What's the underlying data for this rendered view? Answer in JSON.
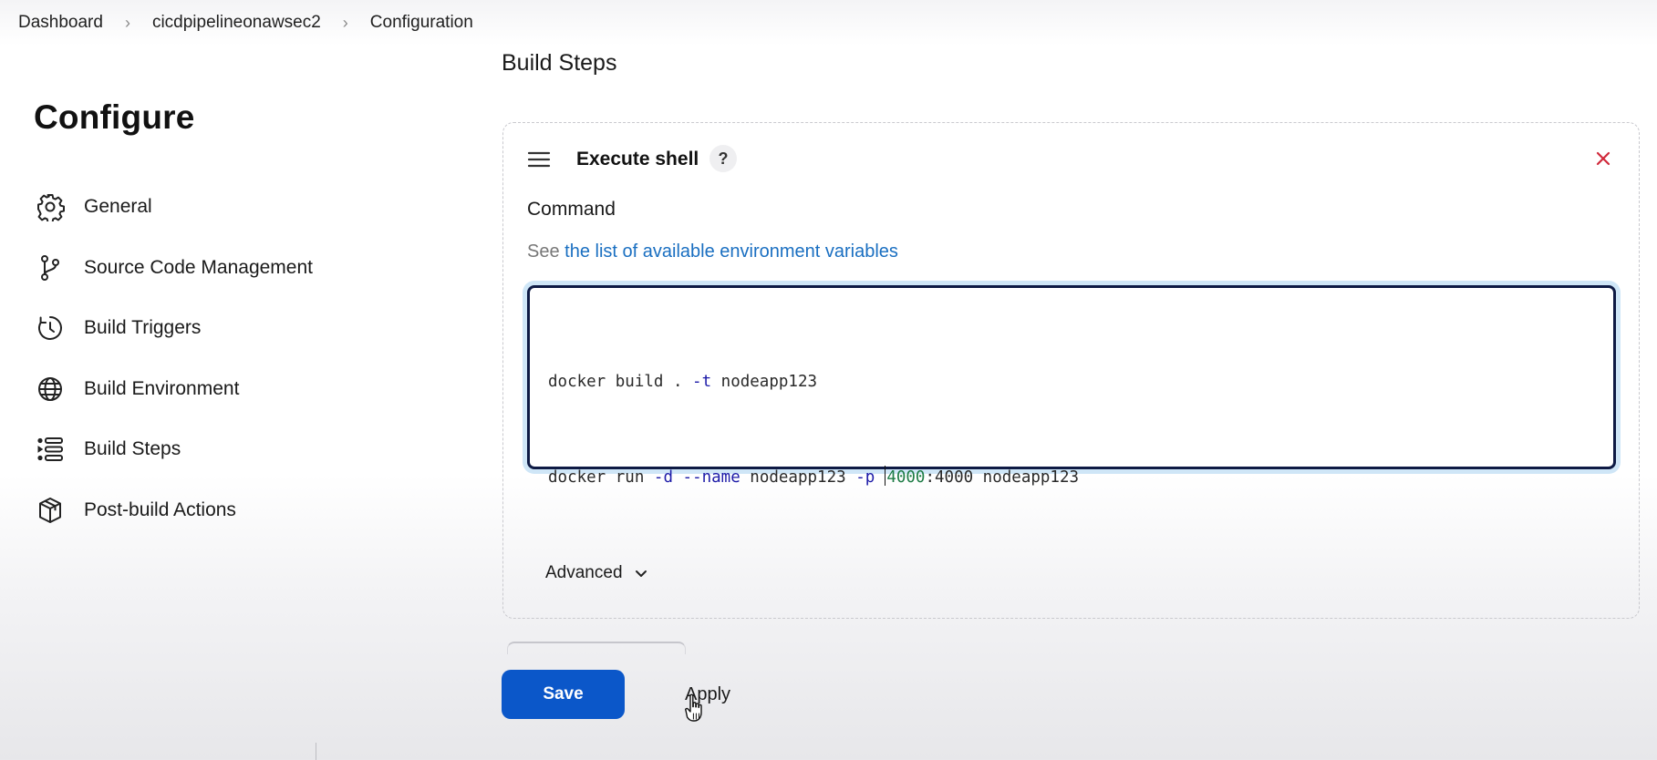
{
  "breadcrumb": {
    "items": [
      "Dashboard",
      "cicdpipelineonawsec2",
      "Configuration"
    ]
  },
  "sidebar": {
    "title": "Configure",
    "items": [
      {
        "label": "General",
        "icon": "gear-icon"
      },
      {
        "label": "Source Code Management",
        "icon": "git-branch-icon"
      },
      {
        "label": "Build Triggers",
        "icon": "clock-icon"
      },
      {
        "label": "Build Environment",
        "icon": "globe-icon"
      },
      {
        "label": "Build Steps",
        "icon": "list-icon"
      },
      {
        "label": "Post-build Actions",
        "icon": "package-icon"
      }
    ]
  },
  "main": {
    "section_title": "Build Steps",
    "step": {
      "title": "Execute shell",
      "help": "?",
      "command_label": "Command",
      "hint_prefix": "See",
      "hint_link": "the list of available environment variables",
      "command_lines": [
        "docker build . -t nodeapp123",
        "docker run -d --name nodeapp123 -p 4000:4000 nodeapp123"
      ],
      "advanced_label": "Advanced"
    }
  },
  "footer": {
    "save_label": "Save",
    "apply_label": "Apply"
  },
  "colors": {
    "accent": "#0b57c9",
    "link": "#1a6fc1",
    "close": "#d0283a",
    "focus_ring": "#cfe6f7",
    "flag_token": "#1d1ba8",
    "number_token": "#1e7c45"
  }
}
